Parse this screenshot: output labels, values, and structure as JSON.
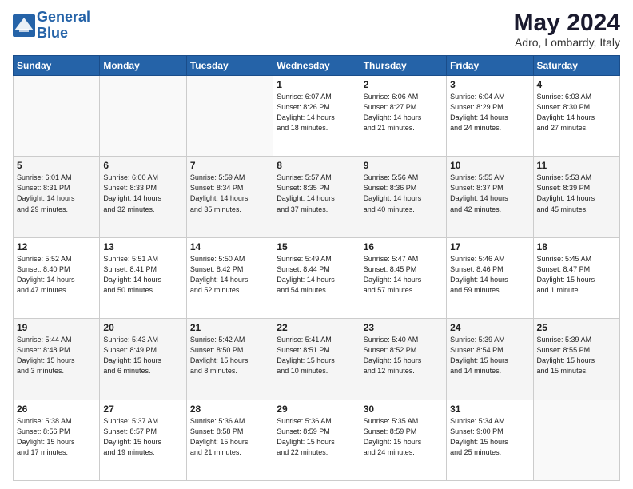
{
  "header": {
    "logo_line1": "General",
    "logo_line2": "Blue",
    "month_year": "May 2024",
    "location": "Adro, Lombardy, Italy"
  },
  "days_of_week": [
    "Sunday",
    "Monday",
    "Tuesday",
    "Wednesday",
    "Thursday",
    "Friday",
    "Saturday"
  ],
  "weeks": [
    [
      {
        "day": "",
        "info": ""
      },
      {
        "day": "",
        "info": ""
      },
      {
        "day": "",
        "info": ""
      },
      {
        "day": "1",
        "info": "Sunrise: 6:07 AM\nSunset: 8:26 PM\nDaylight: 14 hours\nand 18 minutes."
      },
      {
        "day": "2",
        "info": "Sunrise: 6:06 AM\nSunset: 8:27 PM\nDaylight: 14 hours\nand 21 minutes."
      },
      {
        "day": "3",
        "info": "Sunrise: 6:04 AM\nSunset: 8:29 PM\nDaylight: 14 hours\nand 24 minutes."
      },
      {
        "day": "4",
        "info": "Sunrise: 6:03 AM\nSunset: 8:30 PM\nDaylight: 14 hours\nand 27 minutes."
      }
    ],
    [
      {
        "day": "5",
        "info": "Sunrise: 6:01 AM\nSunset: 8:31 PM\nDaylight: 14 hours\nand 29 minutes."
      },
      {
        "day": "6",
        "info": "Sunrise: 6:00 AM\nSunset: 8:33 PM\nDaylight: 14 hours\nand 32 minutes."
      },
      {
        "day": "7",
        "info": "Sunrise: 5:59 AM\nSunset: 8:34 PM\nDaylight: 14 hours\nand 35 minutes."
      },
      {
        "day": "8",
        "info": "Sunrise: 5:57 AM\nSunset: 8:35 PM\nDaylight: 14 hours\nand 37 minutes."
      },
      {
        "day": "9",
        "info": "Sunrise: 5:56 AM\nSunset: 8:36 PM\nDaylight: 14 hours\nand 40 minutes."
      },
      {
        "day": "10",
        "info": "Sunrise: 5:55 AM\nSunset: 8:37 PM\nDaylight: 14 hours\nand 42 minutes."
      },
      {
        "day": "11",
        "info": "Sunrise: 5:53 AM\nSunset: 8:39 PM\nDaylight: 14 hours\nand 45 minutes."
      }
    ],
    [
      {
        "day": "12",
        "info": "Sunrise: 5:52 AM\nSunset: 8:40 PM\nDaylight: 14 hours\nand 47 minutes."
      },
      {
        "day": "13",
        "info": "Sunrise: 5:51 AM\nSunset: 8:41 PM\nDaylight: 14 hours\nand 50 minutes."
      },
      {
        "day": "14",
        "info": "Sunrise: 5:50 AM\nSunset: 8:42 PM\nDaylight: 14 hours\nand 52 minutes."
      },
      {
        "day": "15",
        "info": "Sunrise: 5:49 AM\nSunset: 8:44 PM\nDaylight: 14 hours\nand 54 minutes."
      },
      {
        "day": "16",
        "info": "Sunrise: 5:47 AM\nSunset: 8:45 PM\nDaylight: 14 hours\nand 57 minutes."
      },
      {
        "day": "17",
        "info": "Sunrise: 5:46 AM\nSunset: 8:46 PM\nDaylight: 14 hours\nand 59 minutes."
      },
      {
        "day": "18",
        "info": "Sunrise: 5:45 AM\nSunset: 8:47 PM\nDaylight: 15 hours\nand 1 minute."
      }
    ],
    [
      {
        "day": "19",
        "info": "Sunrise: 5:44 AM\nSunset: 8:48 PM\nDaylight: 15 hours\nand 3 minutes."
      },
      {
        "day": "20",
        "info": "Sunrise: 5:43 AM\nSunset: 8:49 PM\nDaylight: 15 hours\nand 6 minutes."
      },
      {
        "day": "21",
        "info": "Sunrise: 5:42 AM\nSunset: 8:50 PM\nDaylight: 15 hours\nand 8 minutes."
      },
      {
        "day": "22",
        "info": "Sunrise: 5:41 AM\nSunset: 8:51 PM\nDaylight: 15 hours\nand 10 minutes."
      },
      {
        "day": "23",
        "info": "Sunrise: 5:40 AM\nSunset: 8:52 PM\nDaylight: 15 hours\nand 12 minutes."
      },
      {
        "day": "24",
        "info": "Sunrise: 5:39 AM\nSunset: 8:54 PM\nDaylight: 15 hours\nand 14 minutes."
      },
      {
        "day": "25",
        "info": "Sunrise: 5:39 AM\nSunset: 8:55 PM\nDaylight: 15 hours\nand 15 minutes."
      }
    ],
    [
      {
        "day": "26",
        "info": "Sunrise: 5:38 AM\nSunset: 8:56 PM\nDaylight: 15 hours\nand 17 minutes."
      },
      {
        "day": "27",
        "info": "Sunrise: 5:37 AM\nSunset: 8:57 PM\nDaylight: 15 hours\nand 19 minutes."
      },
      {
        "day": "28",
        "info": "Sunrise: 5:36 AM\nSunset: 8:58 PM\nDaylight: 15 hours\nand 21 minutes."
      },
      {
        "day": "29",
        "info": "Sunrise: 5:36 AM\nSunset: 8:59 PM\nDaylight: 15 hours\nand 22 minutes."
      },
      {
        "day": "30",
        "info": "Sunrise: 5:35 AM\nSunset: 8:59 PM\nDaylight: 15 hours\nand 24 minutes."
      },
      {
        "day": "31",
        "info": "Sunrise: 5:34 AM\nSunset: 9:00 PM\nDaylight: 15 hours\nand 25 minutes."
      },
      {
        "day": "",
        "info": ""
      }
    ]
  ]
}
